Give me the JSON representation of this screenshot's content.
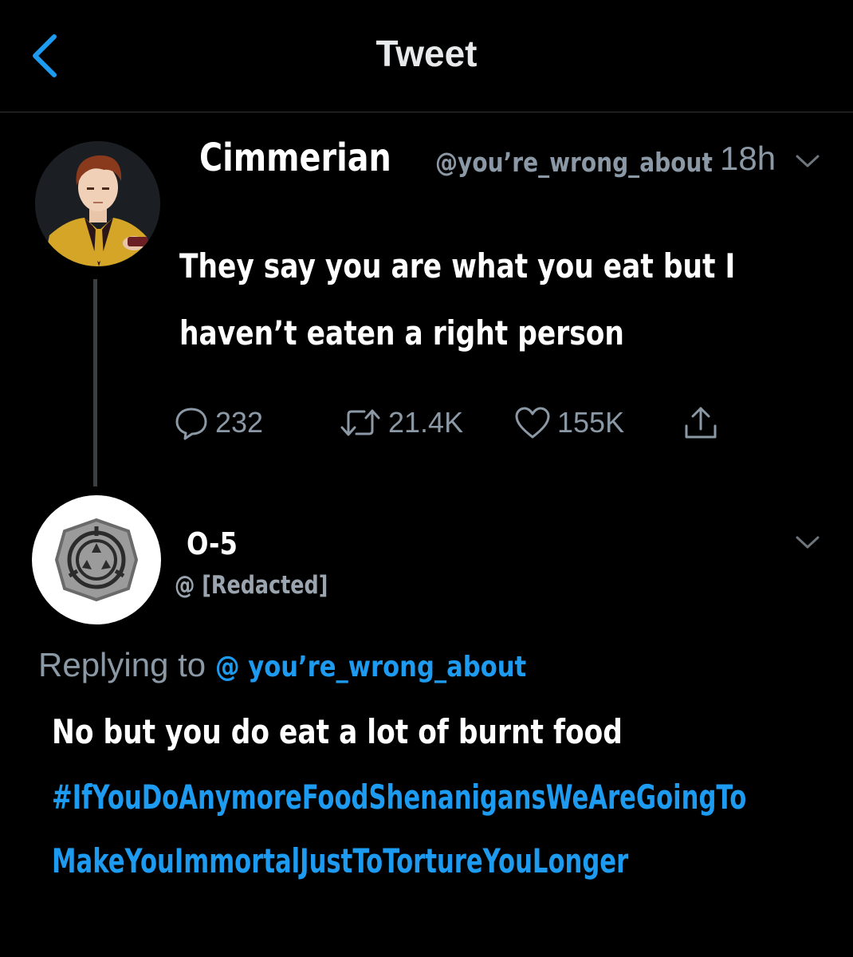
{
  "header": {
    "title": "Tweet"
  },
  "tweet": {
    "author_name": "Cimmerian",
    "author_handle": "@you’re_wrong_about",
    "separator": "·",
    "time": "18h",
    "text_line1": "They say you are what you eat but I",
    "text_line2": "haven’t eaten a right person",
    "actions": {
      "replies": "232",
      "retweets": "21.4K",
      "likes": "155K"
    }
  },
  "reply": {
    "author_name": "O-5",
    "author_handle": "@ [Redacted]",
    "replying_prefix": "Replying to ",
    "replying_to": "@ you’re_wrong_about",
    "text": "No but you do eat a lot of burnt food",
    "hashtag_line1": "#IfYouDoAnymoreFoodShenanigansWeAreGoingTo",
    "hashtag_line2": "MakeYouImmortalJustToTortureYouLonger"
  },
  "icons": {
    "back": "chevron-left-icon",
    "menu": "chevron-down-icon",
    "reply": "reply-icon",
    "retweet": "retweet-icon",
    "like": "heart-icon",
    "share": "share-icon",
    "scp_logo": "scp-logo"
  },
  "colors": {
    "background": "#000000",
    "accent": "#1d9bf0",
    "secondary_text": "#8b98a5"
  }
}
